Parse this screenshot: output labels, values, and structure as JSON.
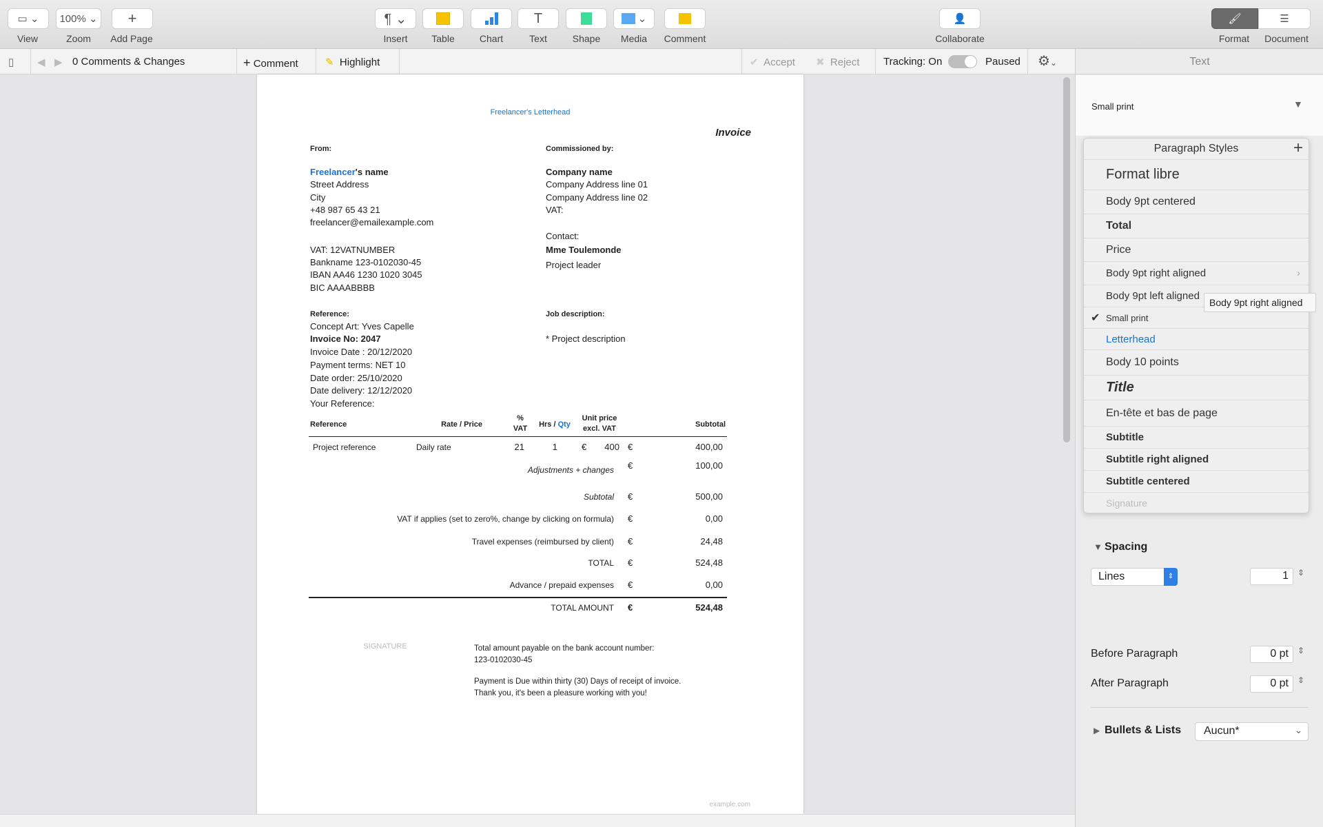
{
  "toolbar": {
    "view": "View",
    "zoom": "Zoom",
    "zoom_value": "100%",
    "add_page": "Add Page",
    "insert": "Insert",
    "table": "Table",
    "chart": "Chart",
    "text": "Text",
    "shape": "Shape",
    "media": "Media",
    "comment": "Comment",
    "collaborate": "Collaborate",
    "format": "Format",
    "document": "Document"
  },
  "review_bar": {
    "comments_count": "0 Comments & Changes",
    "add_comment": "Comment",
    "highlight": "Highlight",
    "accept": "Accept",
    "reject": "Reject",
    "tracking": "Tracking: On",
    "paused": "Paused",
    "tracking_on": true
  },
  "doc": {
    "letterhead": "Freelancer's Letterhead",
    "title": "Invoice",
    "from_label": "From:",
    "freelancer_name_blue": "Freelancer",
    "freelancer_name_rest": "'s name",
    "from_lines": [
      "Street Address",
      "City",
      "+48 987 65 43 21",
      "freelancer@emailexample.com"
    ],
    "bank_lines": [
      "VAT: 12VATNUMBER",
      "Bankname 123-0102030-45",
      "IBAN AA46 1230 1020 3045",
      "BIC AAAABBBB"
    ],
    "reference_label": "Reference:",
    "concept": "Concept Art:  Yves Capelle",
    "invoice_no": "Invoice No: 2047",
    "ref_lines": [
      "Invoice Date :  20/12/2020",
      "Payment terms: NET 10",
      "Date order:  25/10/2020",
      "Date delivery:  12/12/2020",
      "Your Reference:"
    ],
    "commissioned_label": "Commissioned by:",
    "company_name": "Company name",
    "company_lines": [
      "Company Address line 01",
      "Company Address line 02",
      "VAT:"
    ],
    "contact_label": "Contact:",
    "contact_name": "Mme Toulemonde",
    "contact_role": "Project leader",
    "job_label": "Job description:",
    "job_text": "* Project description",
    "table": {
      "headers": {
        "reference": "Reference",
        "rate": "Rate / Price",
        "vat_pct": "%",
        "vat": "VAT",
        "hrs": "Hrs / ",
        "qty": "Qty",
        "unit1": "Unit price",
        "unit2": "excl. VAT",
        "subtotal": "Subtotal"
      },
      "row": {
        "reference": "Project reference",
        "rate": "Daily rate",
        "vat": "21",
        "qty": "1",
        "currency": "€",
        "unit": "400",
        "currency2": "€",
        "subtotal": "400,00"
      },
      "summary": [
        {
          "label": "Adjustments + changes",
          "currency": "€",
          "value": "100,00"
        },
        {
          "label": "Subtotal",
          "currency": "€",
          "value": "500,00"
        },
        {
          "label": "VAT if applies (set to zero%, change by clicking on formula)",
          "currency": "€",
          "value": "0,00"
        },
        {
          "label": "Travel expenses  (reimbursed by client)",
          "currency": "€",
          "value": "24,48"
        },
        {
          "label": "TOTAL",
          "currency": "€",
          "value": "524,48"
        },
        {
          "label": "Advance / prepaid expenses",
          "currency": "€",
          "value": "0,00"
        }
      ],
      "total": {
        "label": "TOTAL AMOUNT",
        "currency": "€",
        "value": "524,48"
      }
    },
    "signature": "SIGNATURE",
    "payment_lines": [
      "Total amount payable on the bank account number:",
      "123-0102030-45",
      "Payment is Due within thirty (30) Days of receipt of invoice.",
      "Thank you, it's been a pleasure working with you!"
    ],
    "footer": "example.com"
  },
  "panel": {
    "tab": "Text",
    "style_selected": "Small print",
    "popover": {
      "title": "Paragraph Styles",
      "items": [
        "Format libre",
        "Body 9pt centered",
        "Total",
        "Price",
        "Body 9pt right aligned",
        "Body 9pt left aligned",
        "Small print",
        "Letterhead",
        "Body 10 points",
        "Title",
        "En-tête et bas de page",
        "Subtitle",
        "Subtitle right aligned",
        "Subtitle centered",
        "Signature"
      ],
      "tooltip": "Body 9pt right aligned"
    },
    "spacing": {
      "label": "Spacing",
      "mode": "Lines",
      "value": "1",
      "before_label": "Before Paragraph",
      "before": "0 pt",
      "after_label": "After Paragraph",
      "after": "0 pt"
    },
    "bullets": {
      "label": "Bullets & Lists",
      "value": "Aucun*"
    }
  },
  "colors": {
    "accent": "#1a73d0",
    "table_icon": "#f5c400",
    "chart_icon": "#2f86e0",
    "shape_icon": "#3ddc97",
    "comment_icon": "#f5c400"
  }
}
